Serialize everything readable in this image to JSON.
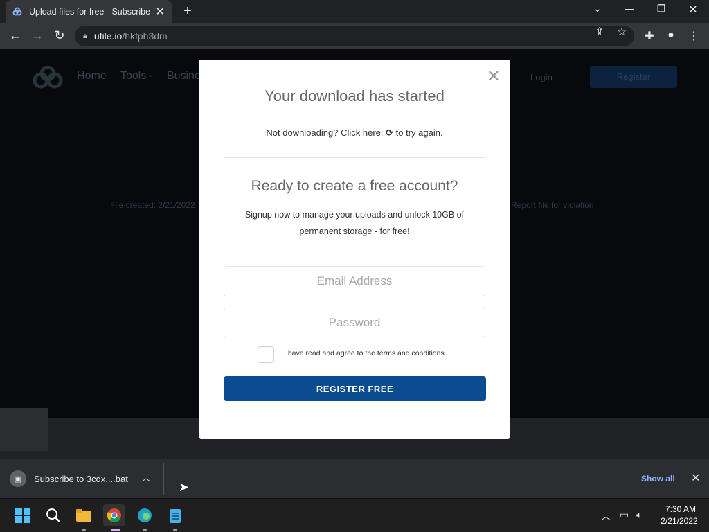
{
  "browser": {
    "tab_title": "Upload files for free - Subscribe t",
    "url_host": "ufile.io",
    "url_path": "/hkfph3dm",
    "new_tab_symbol": "+"
  },
  "site": {
    "nav": [
      "Home",
      "Tools",
      "Busine"
    ],
    "login": "Login",
    "register": "Register",
    "file_created": "File created: 2/21/2022",
    "report": "Report file for violation"
  },
  "modal": {
    "download_title": "Your download has started",
    "retry_prefix": "Not downloading? Click here:",
    "retry_suffix": "to try again.",
    "account_title": "Ready to create a free account?",
    "account_desc": "Signup now to manage your uploads and unlock 10GB of permanent storage - for free!",
    "email_placeholder": "Email Address",
    "password_placeholder": "Password",
    "terms_label": "I have read and agree to the terms and conditions",
    "register_button": "REGISTER FREE"
  },
  "downloads": {
    "file_name": "Subscribe to 3cdx....bat",
    "show_all": "Show all"
  },
  "taskbar": {
    "time": "7:30 AM",
    "date": "2/21/2022"
  },
  "colors": {
    "accent": "#0b4b8f",
    "link": "#8ab4f8"
  }
}
